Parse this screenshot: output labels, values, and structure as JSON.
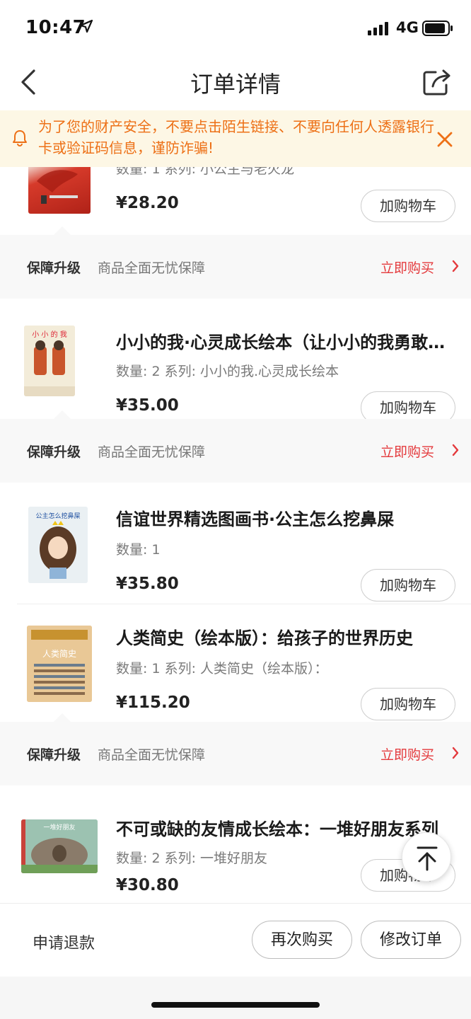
{
  "status_bar": {
    "time": "10:47",
    "network": "4G"
  },
  "header": {
    "title": "订单详情"
  },
  "notice": {
    "text": "为了您的财产安全，不要点击陌生链接、不要向任何人透露银行卡或验证码信息，谨防诈骗!"
  },
  "products": [
    {
      "title": "",
      "meta": "数量: 1 系列: 小公主与老火龙",
      "price": "¥28.20",
      "cart_label": "加购物车"
    },
    {
      "title": "小小的我·心灵成长绘本（让小小的我勇敢地面对成长）",
      "meta": "数量: 2 系列: 小小的我.心灵成长绘本",
      "price": "¥35.00",
      "cart_label": "加购物车"
    },
    {
      "title": "信谊世界精选图画书·公主怎么挖鼻屎",
      "meta": "数量: 1",
      "price": "¥35.80",
      "cart_label": "加购物车"
    },
    {
      "title": "人类简史（绘本版）：给孩子的世界历史",
      "meta": "数量: 1 系列: 人类简史（绘本版）：",
      "price": "¥115.20",
      "cart_label": "加购物车"
    },
    {
      "title": "不可或缺的友情成长绘本：一堆好朋友系列",
      "meta": "数量: 2 系列: 一堆好朋友",
      "price": "¥30.80",
      "cart_label": "加购物车"
    }
  ],
  "guarantee": {
    "label": "保障升级",
    "desc": "商品全面无忧保障",
    "buy_label": "立即购买"
  },
  "bottom_bar": {
    "refund": "申请退款",
    "rebuy": "再次购买",
    "modify": "修改订单"
  },
  "colors": {
    "accent_red": "#e4393c",
    "notice_orange": "#ed7016",
    "notice_bg": "#fdf7e5"
  },
  "icons": [
    "location-arrow-icon",
    "signal-icon",
    "battery-icon",
    "back-icon",
    "share-icon",
    "bell-icon",
    "close-icon",
    "chevron-right-icon",
    "arrow-up-icon"
  ]
}
